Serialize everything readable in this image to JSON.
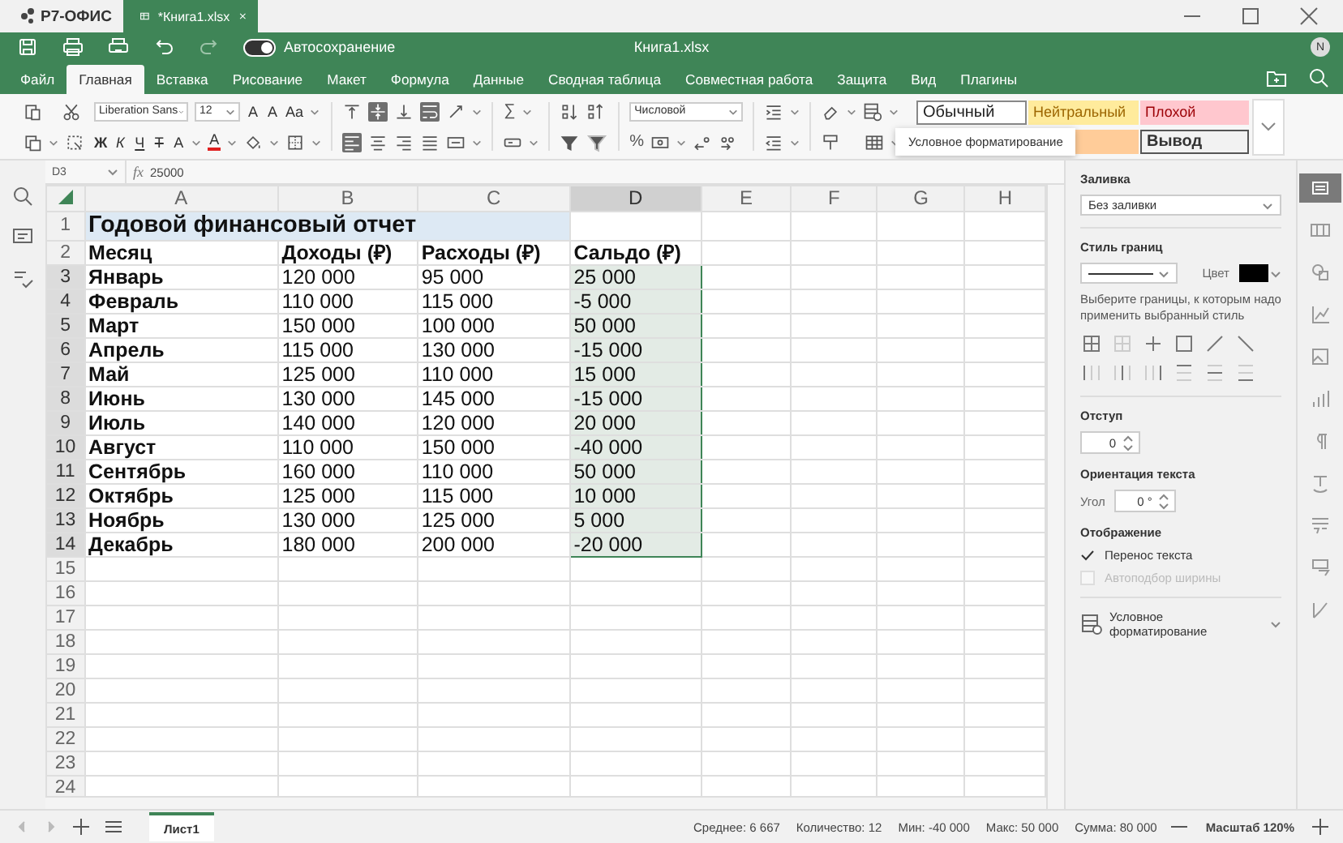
{
  "titlebar": {
    "logo": "Р7-ОФИС",
    "document_tab": "*Книга1.xlsx"
  },
  "header": {
    "autosave_label": "Автосохранение",
    "autosave_on": true,
    "document_title": "Книга1.xlsx",
    "avatar": "N"
  },
  "menu_tabs": [
    {
      "label": "Файл",
      "selected": false
    },
    {
      "label": "Главная",
      "selected": true
    },
    {
      "label": "Вставка",
      "selected": false
    },
    {
      "label": "Рисование",
      "selected": false
    },
    {
      "label": "Макет",
      "selected": false
    },
    {
      "label": "Формула",
      "selected": false
    },
    {
      "label": "Данные",
      "selected": false
    },
    {
      "label": "Сводная таблица",
      "selected": false
    },
    {
      "label": "Совместная работа",
      "selected": false
    },
    {
      "label": "Защита",
      "selected": false
    },
    {
      "label": "Вид",
      "selected": false
    },
    {
      "label": "Плагины",
      "selected": false
    }
  ],
  "toolbar": {
    "font_name": "Liberation Sans",
    "font_size": "12",
    "number_format": "Числовой",
    "sum_label": "∑",
    "percent_label": "%",
    "vertical_align": [
      {
        "selected": false
      },
      {
        "selected": true
      },
      {
        "selected": false
      }
    ],
    "horizontal_align": [
      {
        "selected": true
      },
      {
        "selected": false
      },
      {
        "selected": false
      },
      {
        "selected": false
      }
    ],
    "wrap_text": true,
    "text_buttons": [
      {
        "kind": "grow",
        "label": "A"
      },
      {
        "kind": "shrink",
        "label": "A"
      },
      {
        "kind": "case",
        "label": "Aa"
      },
      {
        "kind": "bold",
        "label": "Ж"
      },
      {
        "kind": "italic",
        "label": "К"
      },
      {
        "kind": "underline",
        "label": "Ч"
      },
      {
        "kind": "strike",
        "label": "Т"
      },
      {
        "kind": "subscript",
        "label": "A"
      },
      {
        "kind": "color",
        "label": "A"
      }
    ],
    "cell_styles": [
      {
        "kind": "normal",
        "label": "Обычный"
      },
      {
        "kind": "neutral",
        "label": "Нейтральный"
      },
      {
        "kind": "bad",
        "label": "Плохой"
      },
      {
        "kind": "accent"
      },
      {
        "kind": "output",
        "label": "Вывод"
      }
    ],
    "tooltip": "Условное форматирование"
  },
  "formula_bar": {
    "cell": "D3",
    "function_label": "fx",
    "formula": "25000"
  },
  "sheet": {
    "columns": [
      {
        "label": "A",
        "selected": false
      },
      {
        "label": "B",
        "selected": false
      },
      {
        "label": "C",
        "selected": false
      },
      {
        "label": "D",
        "selected": true
      },
      {
        "label": "E",
        "selected": false
      },
      {
        "label": "F",
        "selected": false
      },
      {
        "label": "G",
        "selected": false
      },
      {
        "label": "H",
        "selected": false
      }
    ],
    "rows": [
      {
        "number": "1",
        "selected": false,
        "kind": "title",
        "cells": [
          "Годовой финансовый отчет"
        ]
      },
      {
        "number": "2",
        "selected": false,
        "kind": "header",
        "cells": [
          "Месяц",
          "Доходы (₽)",
          "Расходы (₽)",
          "Сальдо (₽)"
        ]
      },
      {
        "number": "3",
        "selected": true,
        "kind": "data",
        "cells": [
          "Январь",
          "120 000",
          "95 000",
          "25 000"
        ]
      },
      {
        "number": "4",
        "selected": true,
        "kind": "data",
        "cells": [
          "Февраль",
          "110 000",
          "115 000",
          "-5 000"
        ]
      },
      {
        "number": "5",
        "selected": true,
        "kind": "data",
        "cells": [
          "Март",
          "150 000",
          "100 000",
          "50 000"
        ]
      },
      {
        "number": "6",
        "selected": true,
        "kind": "data",
        "cells": [
          "Апрель",
          "115 000",
          "130 000",
          "-15 000"
        ]
      },
      {
        "number": "7",
        "selected": true,
        "kind": "data",
        "cells": [
          "Май",
          "125 000",
          "110 000",
          "15 000"
        ]
      },
      {
        "number": "8",
        "selected": true,
        "kind": "data",
        "cells": [
          "Июнь",
          "130 000",
          "145 000",
          "-15 000"
        ]
      },
      {
        "number": "9",
        "selected": true,
        "kind": "data",
        "cells": [
          "Июль",
          "140 000",
          "120 000",
          "20 000"
        ]
      },
      {
        "number": "10",
        "selected": true,
        "kind": "data",
        "cells": [
          "Август",
          "110 000",
          "150 000",
          "-40 000"
        ]
      },
      {
        "number": "11",
        "selected": true,
        "kind": "data",
        "cells": [
          "Сентябрь",
          "160 000",
          "110 000",
          "50 000"
        ]
      },
      {
        "number": "12",
        "selected": true,
        "kind": "data",
        "cells": [
          "Октябрь",
          "125 000",
          "115 000",
          "10 000"
        ]
      },
      {
        "number": "13",
        "selected": true,
        "kind": "data",
        "cells": [
          "Ноябрь",
          "130 000",
          "125 000",
          "5 000"
        ]
      },
      {
        "number": "14",
        "selected": true,
        "kind": "data",
        "cells": [
          "Декабрь",
          "180 000",
          "200 000",
          "-20 000"
        ]
      },
      {
        "number": "15",
        "selected": false,
        "kind": "data"
      },
      {
        "number": "16",
        "selected": false,
        "kind": "data"
      },
      {
        "number": "17",
        "selected": false,
        "kind": "data"
      },
      {
        "number": "18",
        "selected": false,
        "kind": "data"
      },
      {
        "number": "19",
        "selected": false,
        "kind": "data"
      },
      {
        "number": "20",
        "selected": false,
        "kind": "data"
      },
      {
        "number": "21",
        "selected": false,
        "kind": "data"
      },
      {
        "number": "22",
        "selected": false,
        "kind": "data"
      },
      {
        "number": "23",
        "selected": false,
        "kind": "data"
      },
      {
        "number": "24",
        "selected": false,
        "kind": "data"
      }
    ]
  },
  "right_panel": {
    "fill_label": "Заливка",
    "fill_value": "Без заливки",
    "border_style_label": "Стиль границ",
    "color_label": "Цвет",
    "border_hint": "Выберите границы, к которым надо применить выбранный стиль",
    "indent_label": "Отступ",
    "indent_value": "0",
    "orientation_label": "Ориентация текста",
    "angle_label": "Угол",
    "angle_value": "0 °",
    "display_label": "Отображение",
    "options": [
      {
        "label": "Перенос текста",
        "checked": true,
        "disabled": false
      },
      {
        "label": "Автоподбор ширины",
        "checked": false,
        "disabled": true
      }
    ],
    "conditional_formatting": "Условное форматирование"
  },
  "side_tabs": [
    {
      "selected": true
    },
    {
      "selected": false
    },
    {
      "selected": false
    },
    {
      "selected": false
    },
    {
      "selected": false
    },
    {
      "selected": false
    },
    {
      "selected": false
    },
    {
      "selected": false
    },
    {
      "selected": false
    },
    {
      "selected": false
    },
    {
      "selected": false
    }
  ],
  "sheet_tabs": [
    {
      "label": "Лист1",
      "selected": true
    }
  ],
  "status": {
    "items": [
      "Среднее: 6 667",
      "Количество: 12",
      "Мин: -40 000",
      "Макс: 50 000",
      "Сумма: 80 000"
    ],
    "zoom": "Масштаб 120%"
  }
}
